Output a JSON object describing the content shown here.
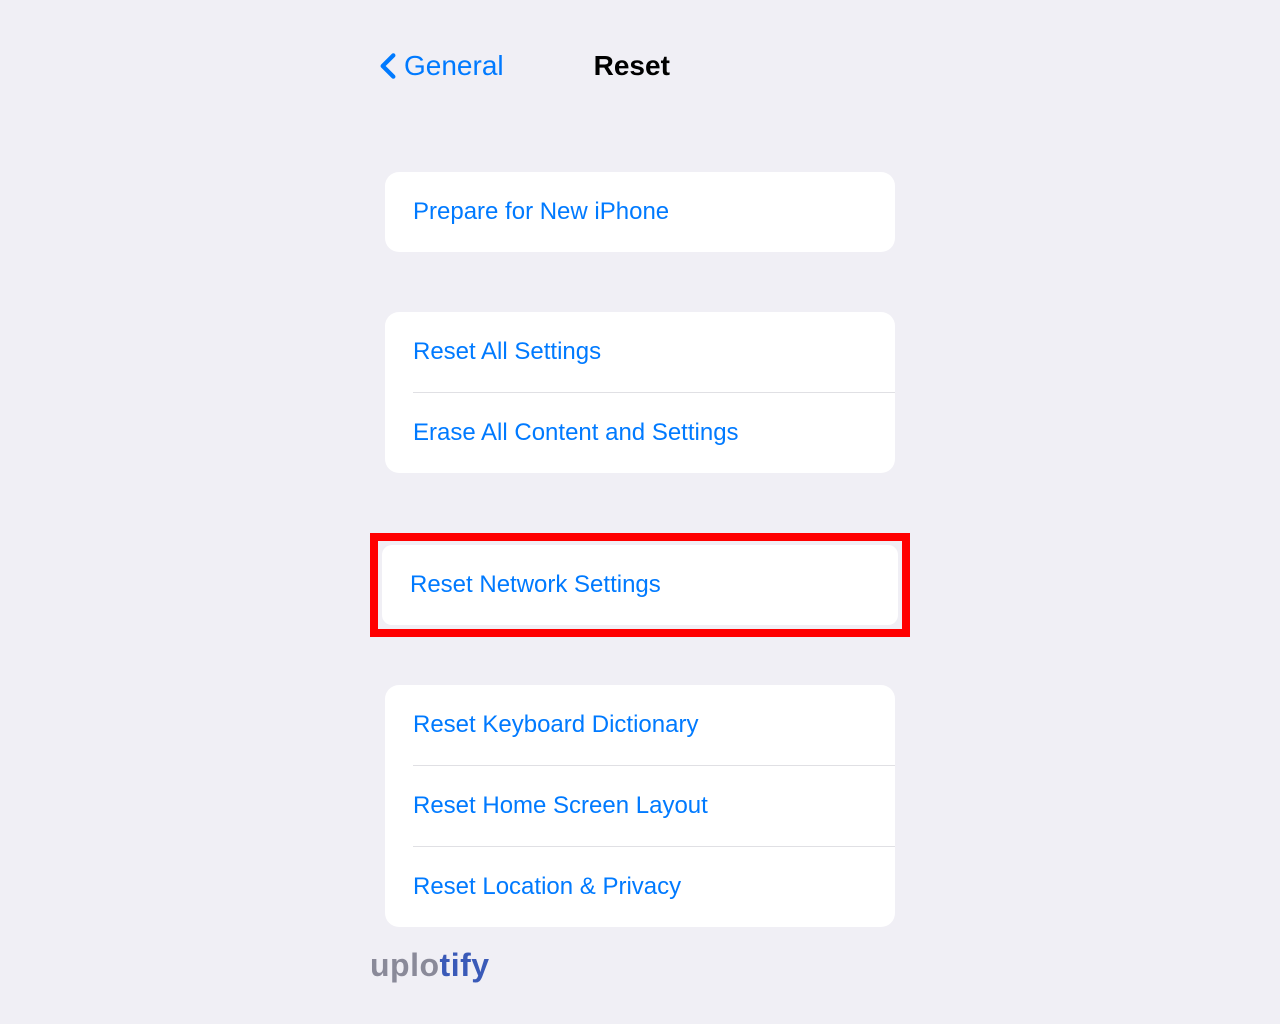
{
  "header": {
    "back_label": "General",
    "title": "Reset"
  },
  "groups": {
    "g1": {
      "item1": "Prepare for New iPhone"
    },
    "g2": {
      "item1": "Reset All Settings",
      "item2": "Erase All Content and Settings"
    },
    "g3": {
      "item1": "Reset Network Settings"
    },
    "g4": {
      "item1": "Reset Keyboard Dictionary",
      "item2": "Reset Home Screen Layout",
      "item3": "Reset Location & Privacy"
    }
  },
  "watermark": {
    "part1": "uplo",
    "part2": "tify"
  }
}
